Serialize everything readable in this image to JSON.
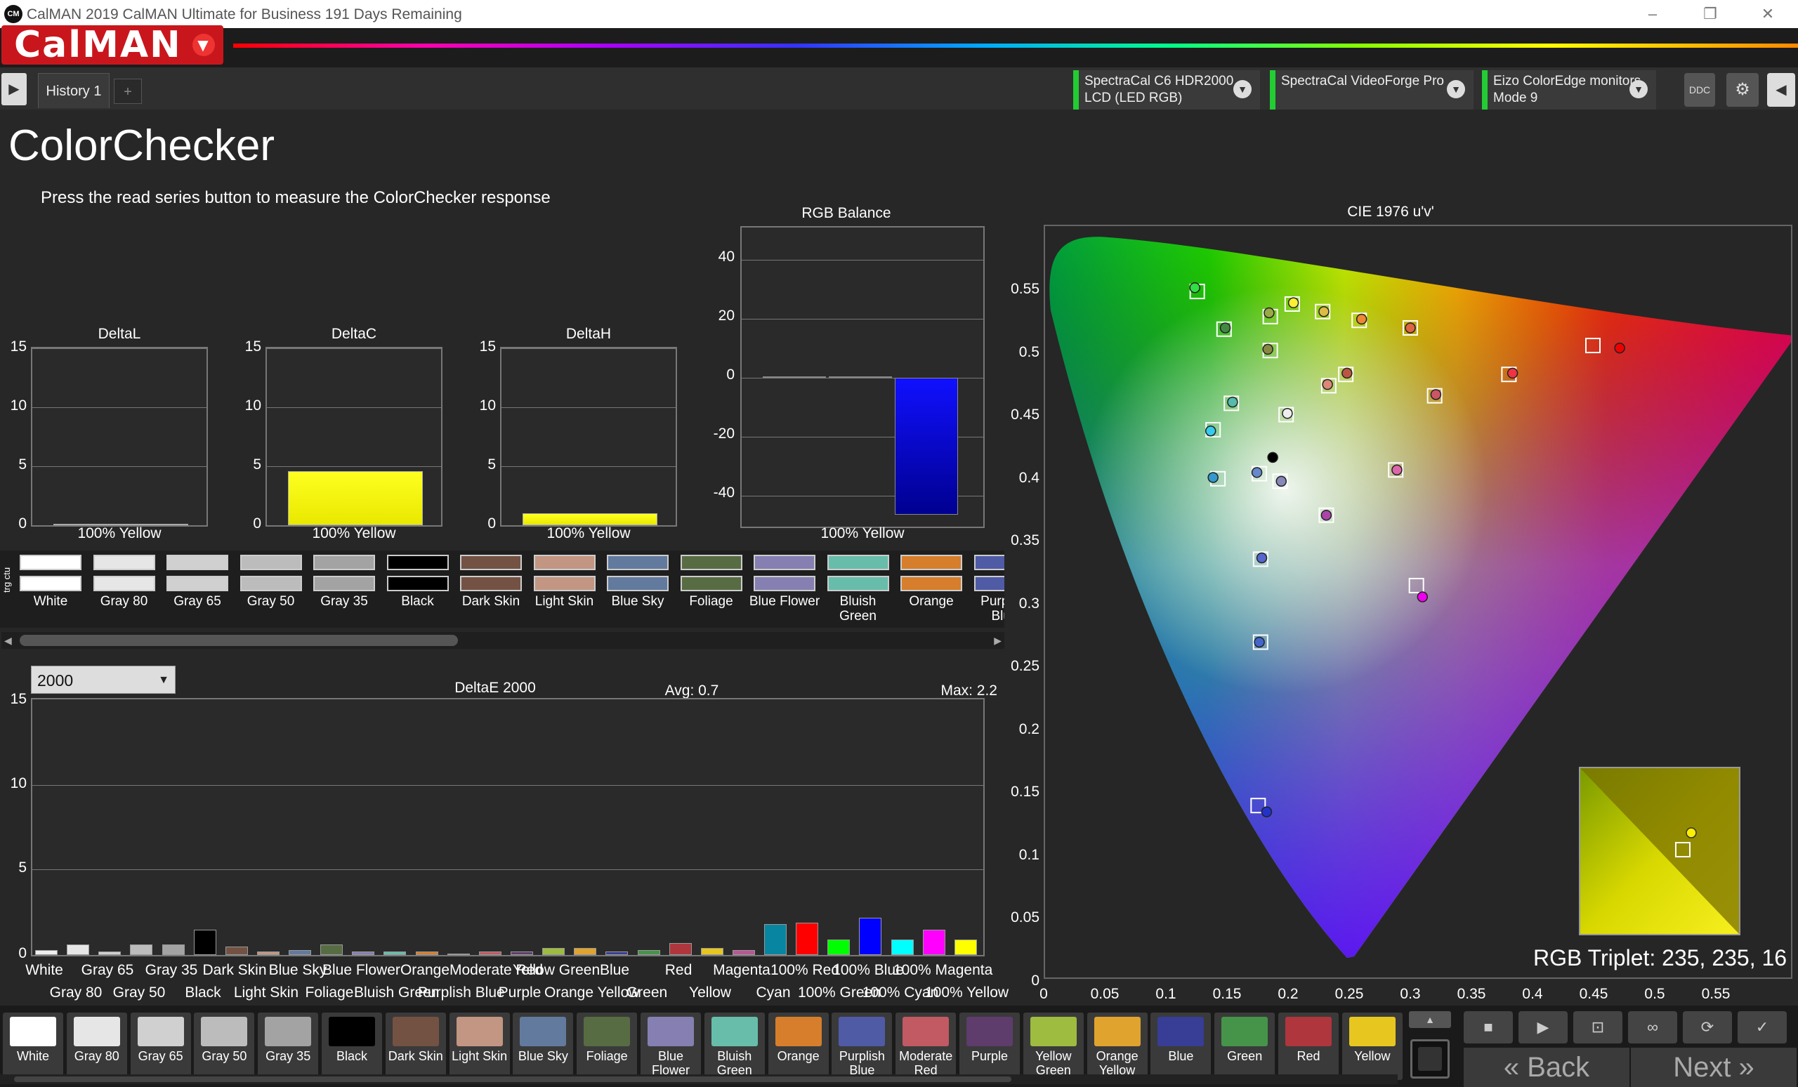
{
  "window": {
    "title": "CalMAN 2019 CalMAN Ultimate for Business 191 Days Remaining",
    "icon_text": "CM"
  },
  "logo": {
    "text": "CalMAN"
  },
  "tabs": [
    {
      "label": "History 1"
    }
  ],
  "devices": [
    {
      "line1": "SpectraCal C6 HDR2000",
      "line2": "LCD (LED RGB)"
    },
    {
      "line1": "SpectraCal VideoForge Pro",
      "line2": ""
    },
    {
      "line1": "Eizo ColorEdge monitors",
      "line2": "Mode 9"
    }
  ],
  "toolbar": {
    "ddc_label": "DDC"
  },
  "page": {
    "title": "ColorChecker",
    "instruction": "Press the read series button to measure the ColorChecker response"
  },
  "delta_charts": [
    {
      "title": "DeltaL",
      "category": "100% Yellow",
      "value": 0
    },
    {
      "title": "DeltaC",
      "category": "100% Yellow",
      "value": 4.6
    },
    {
      "title": "DeltaH",
      "category": "100% Yellow",
      "value": 1.0
    }
  ],
  "delta_ticks": [
    "15",
    "10",
    "5",
    "0"
  ],
  "rgb_balance": {
    "title": "RGB Balance",
    "category": "100% Yellow",
    "ticks": [
      "40",
      "20",
      "0",
      "-20",
      "-40"
    ]
  },
  "swatch_strip": {
    "side_label": "trg ctu",
    "items": [
      {
        "label": "White",
        "color": "#ffffff"
      },
      {
        "label": "Gray 80",
        "color": "#e6e6e6"
      },
      {
        "label": "Gray 65",
        "color": "#d0d0d0"
      },
      {
        "label": "Gray 50",
        "color": "#bcbcbc"
      },
      {
        "label": "Gray 35",
        "color": "#a3a3a3"
      },
      {
        "label": "Black",
        "color": "#000000"
      },
      {
        "label": "Dark Skin",
        "color": "#735244"
      },
      {
        "label": "Light Skin",
        "color": "#c29682"
      },
      {
        "label": "Blue Sky",
        "color": "#627a9d"
      },
      {
        "label": "Foliage",
        "color": "#576c43"
      },
      {
        "label": "Blue Flower",
        "color": "#8580b1"
      },
      {
        "label": "Bluish Green",
        "color": "#67bdaa"
      },
      {
        "label": "Orange",
        "color": "#d67e2c"
      },
      {
        "label": "Purplish Blue",
        "color": "#505ba6"
      }
    ]
  },
  "deltae": {
    "selector": "2000",
    "title": "DeltaE 2000",
    "avg": "Avg: 0.7",
    "max": "Max: 2.2",
    "ticks": [
      "15",
      "10",
      "5",
      "0"
    ]
  },
  "chart_data": [
    {
      "type": "bar",
      "title": "DeltaL",
      "categories": [
        "100% Yellow"
      ],
      "values": [
        0
      ],
      "ylim": [
        0,
        15
      ]
    },
    {
      "type": "bar",
      "title": "DeltaC",
      "categories": [
        "100% Yellow"
      ],
      "values": [
        4.6
      ],
      "ylim": [
        0,
        15
      ]
    },
    {
      "type": "bar",
      "title": "DeltaH",
      "categories": [
        "100% Yellow"
      ],
      "values": [
        1.0
      ],
      "ylim": [
        0,
        15
      ]
    },
    {
      "type": "bar",
      "title": "RGB Balance",
      "categories": [
        "100% Yellow"
      ],
      "series": [
        {
          "values": [
            0.5
          ],
          "color": "#ff0000"
        },
        {
          "values": [
            0.5
          ],
          "color": "#00ff00"
        },
        {
          "values": [
            -46.5
          ],
          "color": "#0000ff"
        }
      ],
      "ylim": [
        -50,
        50
      ]
    },
    {
      "type": "bar",
      "title": "DeltaE 2000",
      "categories": [
        "White",
        "Gray 80",
        "Gray 65",
        "Gray 50",
        "Gray 35",
        "Black",
        "Dark Skin",
        "Light Skin",
        "Blue Sky",
        "Foliage",
        "Blue Flower",
        "Bluish Green",
        "Orange",
        "Purplish Blue",
        "Moderate Red",
        "Purple",
        "Yellow Green",
        "Orange Yellow",
        "Blue",
        "Green",
        "Red",
        "Yellow",
        "Magenta",
        "Cyan",
        "100% Red",
        "100% Green",
        "100% Blue",
        "100% Cyan",
        "100% Magenta",
        "100% Yellow"
      ],
      "values": [
        0.3,
        0.6,
        0.2,
        0.6,
        0.6,
        1.5,
        0.5,
        0.2,
        0.3,
        0.6,
        0.2,
        0.2,
        0.2,
        0.1,
        0.2,
        0.2,
        0.4,
        0.4,
        0.2,
        0.3,
        0.7,
        0.4,
        0.3,
        1.8,
        1.9,
        0.9,
        2.2,
        0.9,
        1.5,
        0.9
      ],
      "colors": [
        "#eeeeee",
        "#e6e6e6",
        "#d0d0d0",
        "#bcbcbc",
        "#a3a3a3",
        "#000000",
        "#735244",
        "#c29682",
        "#627a9d",
        "#576c43",
        "#8580b1",
        "#67bdaa",
        "#d67e2c",
        "#505ba6",
        "#c15a63",
        "#5e3c6c",
        "#9dbc40",
        "#e0a32e",
        "#383d96",
        "#469449",
        "#af363c",
        "#e7c71f",
        "#bb5695",
        "#0885a1",
        "#ff0000",
        "#00ff00",
        "#0000ff",
        "#00ffff",
        "#ff00ff",
        "#ffff00"
      ],
      "ylim": [
        0,
        15
      ]
    },
    {
      "type": "scatter",
      "title": "CIE 1976 u'v'",
      "xlim": [
        0,
        0.6
      ],
      "ylim": [
        0,
        0.6
      ],
      "x_ticks": [
        "0",
        "0.05",
        "0.1",
        "0.15",
        "0.2",
        "0.25",
        "0.3",
        "0.35",
        "0.4",
        "0.45",
        "0.5",
        "0.55"
      ],
      "y_ticks": [
        "0.55",
        "0.5",
        "0.45",
        "0.4",
        "0.35",
        "0.3",
        "0.25",
        "0.2",
        "0.15",
        "0.1",
        "0.05",
        "0"
      ],
      "targets": [
        [
          0.125,
          0.567
        ],
        [
          0.147,
          0.537
        ],
        [
          0.185,
          0.547
        ],
        [
          0.203,
          0.557
        ],
        [
          0.228,
          0.551
        ],
        [
          0.258,
          0.544
        ],
        [
          0.3,
          0.538
        ],
        [
          0.185,
          0.52
        ],
        [
          0.247,
          0.501
        ],
        [
          0.233,
          0.492
        ],
        [
          0.381,
          0.501
        ],
        [
          0.45,
          0.524
        ],
        [
          0.32,
          0.484
        ],
        [
          0.153,
          0.478
        ],
        [
          0.198,
          0.469
        ],
        [
          0.138,
          0.457
        ],
        [
          0.176,
          0.422
        ],
        [
          0.193,
          0.416
        ],
        [
          0.288,
          0.425
        ],
        [
          0.142,
          0.418
        ],
        [
          0.231,
          0.389
        ],
        [
          0.177,
          0.354
        ],
        [
          0.305,
          0.333
        ],
        [
          0.177,
          0.288
        ],
        [
          0.175,
          0.158
        ]
      ],
      "measured": [
        [
          0.123,
          0.57
        ],
        [
          0.148,
          0.538
        ],
        [
          0.184,
          0.55
        ],
        [
          0.204,
          0.558
        ],
        [
          0.229,
          0.551
        ],
        [
          0.26,
          0.545
        ],
        [
          0.3,
          0.538
        ],
        [
          0.183,
          0.521
        ],
        [
          0.248,
          0.502
        ],
        [
          0.232,
          0.493
        ],
        [
          0.384,
          0.502
        ],
        [
          0.472,
          0.522
        ],
        [
          0.321,
          0.485
        ],
        [
          0.154,
          0.479
        ],
        [
          0.199,
          0.47
        ],
        [
          0.136,
          0.456
        ],
        [
          0.174,
          0.423
        ],
        [
          0.194,
          0.416
        ],
        [
          0.289,
          0.425
        ],
        [
          0.138,
          0.419
        ],
        [
          0.231,
          0.389
        ],
        [
          0.178,
          0.355
        ],
        [
          0.31,
          0.324
        ],
        [
          0.176,
          0.288
        ],
        [
          0.182,
          0.153
        ],
        [
          0.187,
          0.435
        ]
      ],
      "measured_colors": [
        "#33dd44",
        "#448844",
        "#99aa44",
        "#ffee33",
        "#ddbb44",
        "#ee8833",
        "#dd6644",
        "#888844",
        "#bb5544",
        "#dd8877",
        "#ee3344",
        "#ee0000",
        "#cc5566",
        "#55bbaa",
        "#eeeeee",
        "#33ccee",
        "#6688cc",
        "#8888bb",
        "#dd66aa",
        "#3399cc",
        "#aa44aa",
        "#5566cc",
        "#ee00ee",
        "#4466cc",
        "#2233cc",
        "#000000"
      ]
    },
    {
      "type": "scatter",
      "title": "RGB Triplet: 235, 235, 16"
    }
  ],
  "cie": {
    "title": "CIE 1976 u'v'",
    "triplet": "RGB Triplet: 235, 235, 16"
  },
  "bottom_swatches": [
    {
      "label": "White",
      "color": "#ffffff"
    },
    {
      "label": "Gray 80",
      "color": "#e6e6e6"
    },
    {
      "label": "Gray 65",
      "color": "#d0d0d0"
    },
    {
      "label": "Gray 50",
      "color": "#bcbcbc"
    },
    {
      "label": "Gray 35",
      "color": "#a3a3a3"
    },
    {
      "label": "Black",
      "color": "#000000"
    },
    {
      "label": "Dark Skin",
      "color": "#735244"
    },
    {
      "label": "Light Skin",
      "color": "#c29682"
    },
    {
      "label": "Blue Sky",
      "color": "#627a9d"
    },
    {
      "label": "Foliage",
      "color": "#576c43"
    },
    {
      "label": "Blue Flower",
      "color": "#8580b1"
    },
    {
      "label": "Bluish Green",
      "color": "#67bdaa"
    },
    {
      "label": "Orange",
      "color": "#d67e2c"
    },
    {
      "label": "Purplish Blue",
      "color": "#505ba6"
    },
    {
      "label": "Moderate Red",
      "color": "#c15a63"
    },
    {
      "label": "Purple",
      "color": "#5e3c6c"
    },
    {
      "label": "Yellow Green",
      "color": "#9dbc40"
    },
    {
      "label": "Orange Yellow",
      "color": "#e0a32e"
    },
    {
      "label": "Blue",
      "color": "#383d96"
    },
    {
      "label": "Green",
      "color": "#469449"
    },
    {
      "label": "Red",
      "color": "#af363c"
    },
    {
      "label": "Yellow",
      "color": "#e7c71f"
    }
  ],
  "nav": {
    "back": "Back",
    "next": "Next"
  }
}
